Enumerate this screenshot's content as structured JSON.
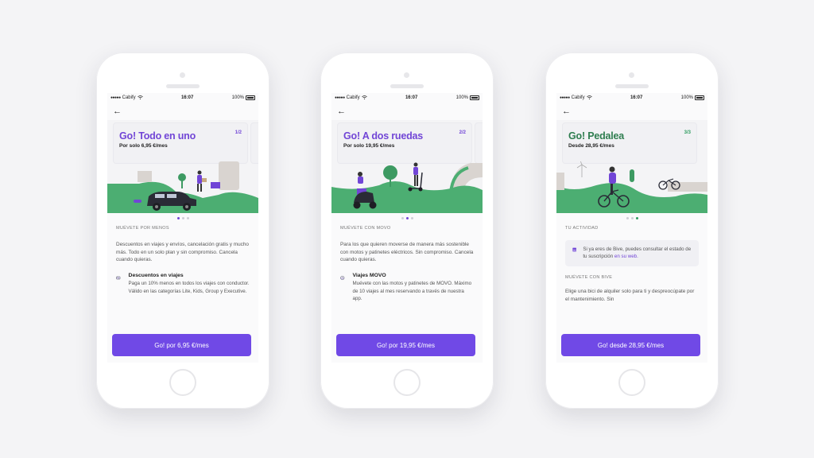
{
  "statusbar": {
    "carrier": "Cabify",
    "time": "16:07",
    "battery": "100%"
  },
  "screens": [
    {
      "card_title": "Go! Todo en uno",
      "card_price": "Por solo 6,95 €/mes",
      "card_page": "1/2",
      "section": "MUÉVETE POR MENOS",
      "paragraph": "Descuentos en viajes y envíos, cancelación gratis y mucho más. Todo en un solo plan y sin compromiso. Cancela cuando quieras.",
      "feature_title": "Descuentos en viajes",
      "feature_body": "Paga un 10% menos en todos los viajes con conductor. Válido en las categorías Lite, Kids, Group y Executive.",
      "cta": "Go! por 6,95 €/mes",
      "active_dot": 0
    },
    {
      "card_title": "Go! A dos ruedas",
      "card_price": "Por solo 19,95 €/mes",
      "card_page": "2/2",
      "section": "MUÉVETE CON MOVO",
      "paragraph": "Para los que quieren moverse de manera más sostenible con motos y patinetes eléctricos. Sin compromiso. Cancela cuando quieras.",
      "feature_title": "Viajes MOVO",
      "feature_body": "Muévete con las motos y patinetes de MOVO. Máximo de 10 viajes al mes reservando a través de nuestra app.",
      "cta": "Go! por 19,95 €/mes",
      "active_dot": 1
    },
    {
      "card_title": "Go! Pedalea",
      "card_price": "Desde 28,95 €/mes",
      "card_page": "3/3",
      "section": "TU ACTIVIDAD",
      "info_text": "Si ya eres de Bive, puedes consultar el estado de tu suscripción ",
      "info_link": "en su web.",
      "section2": "MUÉVETE CON BIVE",
      "paragraph": "Elige una bici de alquiler solo para ti y despreocúpate por el mantenimiento. Sin",
      "cta": "Go! desde 28,95 €/mes",
      "active_dot": 2
    }
  ],
  "colors": {
    "accent": "#7049e6",
    "title_purple": "#7145d6",
    "title_green": "#2e7d4f",
    "illustration_green": "#4cae72"
  },
  "icons": [
    "back-arrow-icon",
    "wifi-icon",
    "battery-icon",
    "discount-ticket-icon",
    "scooter-icon",
    "bike-badge-icon"
  ]
}
